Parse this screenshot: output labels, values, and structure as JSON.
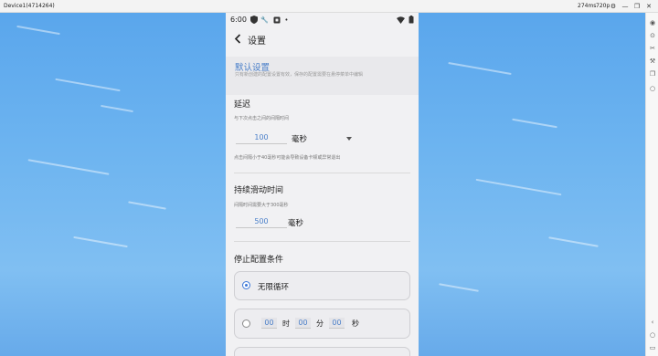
{
  "window": {
    "title": "Device1(4714264)",
    "latency": "274ms",
    "resolution": "720p",
    "controls": [
      "settings-icon",
      "minimize-icon",
      "restore-icon",
      "close-icon"
    ]
  },
  "toolbar": {
    "icons": [
      "eye-icon",
      "screenshot-icon",
      "cut-icon",
      "tools-icon",
      "copy-icon",
      "record-icon",
      "chevron-left-icon",
      "home-icon",
      "recent-apps-icon"
    ]
  },
  "phone": {
    "status": {
      "time": "6:00",
      "left_icons": [
        "shield-icon",
        "wrench-icon",
        "app-icon",
        "dot-icon"
      ],
      "right_icons": [
        "wifi-icon",
        "battery-icon"
      ]
    },
    "appbar": {
      "title": "设置"
    },
    "header": {
      "title": "默认设置",
      "subtitle": "只有新创建的配置设置有效，保存的配置需要在悬停菜单中编辑"
    },
    "delay": {
      "title": "延迟",
      "hint": "与下次点击之间的间隔时间",
      "value": "100",
      "unit": "毫秒",
      "warning": "点击间隔小于40毫秒可能会导致设备卡顿或异常退出"
    },
    "swipe": {
      "title": "持续滑动时间",
      "hint": "间隔时间需要大于300毫秒",
      "value": "500",
      "unit": "毫秒"
    },
    "stop": {
      "title": "停止配置条件",
      "option_infinite": "无限循环",
      "timer": {
        "hours": "00",
        "hours_unit": "时",
        "minutes": "00",
        "minutes_unit": "分",
        "seconds": "00",
        "seconds_unit": "秒"
      }
    }
  },
  "colors": {
    "accent": "#4a7fc9",
    "radio_selected": "#3d78d8"
  }
}
